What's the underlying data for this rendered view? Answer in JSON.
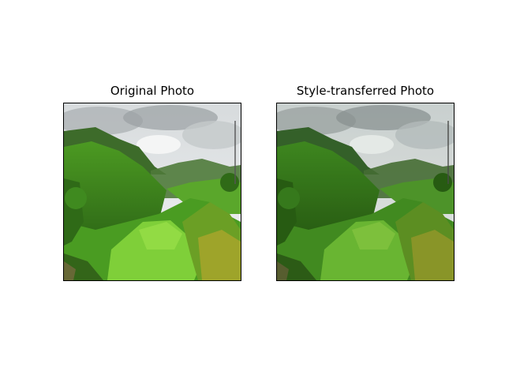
{
  "figure": {
    "panels": [
      {
        "title": "Original Photo"
      },
      {
        "title": "Style-transferred Photo"
      }
    ]
  },
  "colors": {
    "sky_light": "#e6e9ea",
    "cloud_grey": "#9aa0a3",
    "mountain_dark": "#2e5a1e",
    "hill_green": "#3f8a1f",
    "field_light": "#8bd13a",
    "foreground_bright": "#67c12a",
    "shadow": "#1f3d12",
    "foliage_yellow": "#a7a52b",
    "style_tint": "#4f8f2a"
  }
}
